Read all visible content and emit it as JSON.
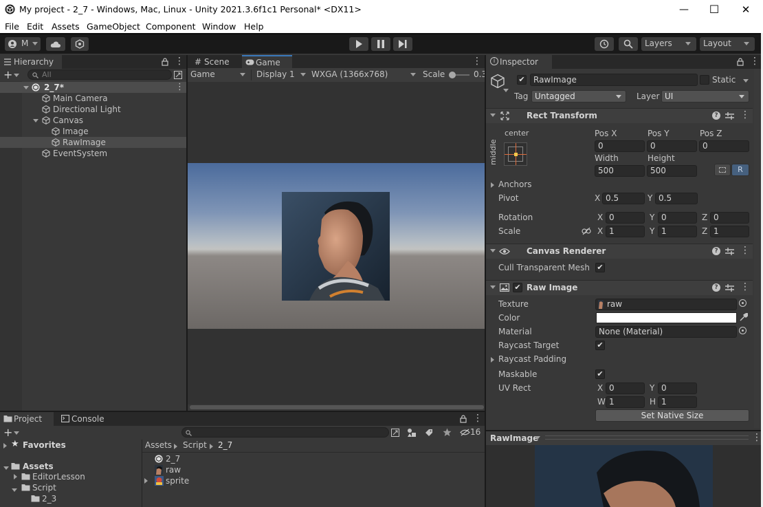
{
  "window": {
    "title": "My project - 2_7 - Windows, Mac, Linux - Unity 2021.3.6f1c1 Personal* <DX11>",
    "minimize": "—",
    "maximize": "☐",
    "close": "✕"
  },
  "menu": [
    "File",
    "Edit",
    "Assets",
    "GameObject",
    "Component",
    "Window",
    "Help"
  ],
  "toolbar": {
    "account_label": "M",
    "layers_label": "Layers",
    "layout_label": "Layout"
  },
  "hierarchy": {
    "tab": "Hierarchy",
    "search_placeholder": "All",
    "scene": "2_7*",
    "items": [
      "Main Camera",
      "Directional Light",
      "Canvas",
      "Image",
      "RawImage",
      "EventSystem"
    ]
  },
  "scene_view": {
    "tabs": [
      "Scene",
      "Game"
    ],
    "game_dropdown": "Game",
    "display_dropdown": "Display 1",
    "resolution_dropdown": "WXGA (1366x768)",
    "scale_label": "Scale",
    "scale_value": "0.3"
  },
  "inspector": {
    "tab": "Inspector",
    "object_name": "RawImage",
    "static_label": "Static",
    "tag_label": "Tag",
    "tag_value": "Untagged",
    "layer_label": "Layer",
    "layer_value": "UI",
    "rect_transform": {
      "title": "Rect Transform",
      "anchor_h": "center",
      "anchor_v": "middle",
      "pos_x_label": "Pos X",
      "pos_y_label": "Pos Y",
      "pos_z_label": "Pos Z",
      "pos_x": "0",
      "pos_y": "0",
      "pos_z": "0",
      "width_label": "Width",
      "height_label": "Height",
      "width": "500",
      "height": "500",
      "r_button": "R",
      "anchors_label": "Anchors",
      "pivot_label": "Pivot",
      "pivot_x": "0.5",
      "pivot_y": "0.5",
      "rotation_label": "Rotation",
      "rot_x": "0",
      "rot_y": "0",
      "rot_z": "0",
      "scale_label": "Scale",
      "scale_x": "1",
      "scale_y": "1",
      "scale_z": "1"
    },
    "canvas_renderer": {
      "title": "Canvas Renderer",
      "cull_label": "Cull Transparent Mesh"
    },
    "raw_image": {
      "title": "Raw Image",
      "texture_label": "Texture",
      "texture_value": "raw",
      "color_label": "Color",
      "material_label": "Material",
      "material_value": "None (Material)",
      "raycast_target_label": "Raycast Target",
      "raycast_padding_label": "Raycast Padding",
      "maskable_label": "Maskable",
      "uv_rect_label": "UV Rect",
      "uv_x": "0",
      "uv_y": "0",
      "uv_w": "1",
      "uv_h": "1",
      "native_size_button": "Set Native Size"
    },
    "preview_label": "RawImage"
  },
  "project": {
    "tabs": [
      "Project",
      "Console"
    ],
    "hidden_count": "16",
    "favorites": "Favorites",
    "assets": "Assets",
    "folders": [
      "EditorLesson",
      "Script",
      "2_3"
    ],
    "breadcrumb": [
      "Assets",
      "Script",
      "2_7"
    ],
    "files": [
      "2_7",
      "raw",
      "sprite"
    ]
  },
  "axis_letters": {
    "x": "X",
    "y": "Y",
    "z": "Z",
    "w": "W",
    "h": "H"
  }
}
